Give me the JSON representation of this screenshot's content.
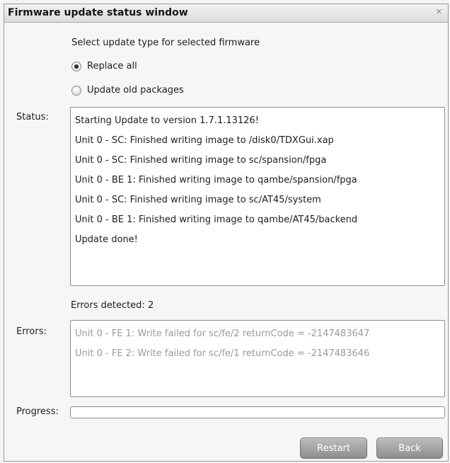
{
  "window": {
    "title": "Firmware update status window"
  },
  "update_type": {
    "prompt": "Select update type for selected firmware",
    "options": [
      {
        "label": "Replace all",
        "selected": true
      },
      {
        "label": "Update old packages",
        "selected": false
      }
    ]
  },
  "status": {
    "label": "Status:",
    "lines": [
      "Starting Update to version 1.7.1.13126!",
      "Unit 0 - SC: Finished writing image to /disk0/TDXGui.xap",
      "Unit 0 - SC: Finished writing image to sc/spansion/fpga",
      "Unit 0 - BE 1: Finished writing image to qambe/spansion/fpga",
      "Unit 0 - SC: Finished writing image to sc/AT45/system",
      "Unit 0 - BE 1: Finished writing image to qambe/AT45/backend",
      "Update done!"
    ]
  },
  "errors": {
    "summary": "Errors detected:  2",
    "label": "Errors:",
    "lines": [
      "Unit 0 - FE 1: Write failed for sc/fe/2 returnCode = -2147483647",
      "Unit 0 - FE 2: Write failed for sc/fe/1 returnCode = -2147483646"
    ]
  },
  "progress": {
    "label": "Progress:",
    "fraction": 0
  },
  "buttons": {
    "restart": "Restart",
    "back": "Back"
  },
  "icons": {
    "close": "close-icon"
  }
}
